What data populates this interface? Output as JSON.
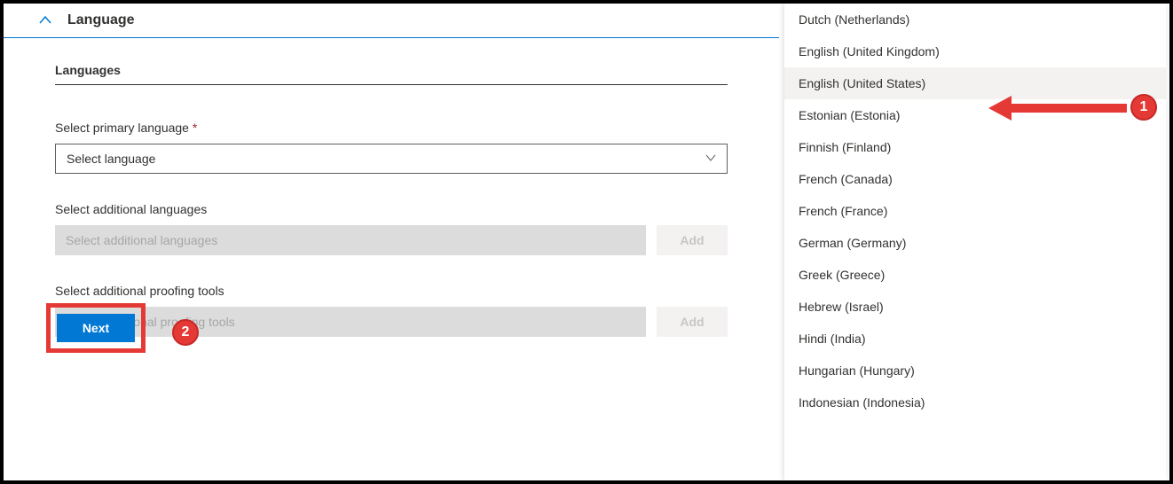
{
  "header": {
    "title": "Language"
  },
  "section": {
    "title": "Languages"
  },
  "primary": {
    "label": "Select primary language",
    "required": "*",
    "placeholder": "Select language"
  },
  "additionalLang": {
    "label": "Select additional languages",
    "placeholder": "Select additional languages",
    "add": "Add"
  },
  "proofing": {
    "label": "Select additional proofing tools",
    "placeholder": "Select additional proofing tools",
    "add": "Add"
  },
  "next": {
    "label": "Next"
  },
  "annot": {
    "b1": "1",
    "b2": "2"
  },
  "options": [
    "Dutch (Netherlands)",
    "English (United Kingdom)",
    "English (United States)",
    "Estonian (Estonia)",
    "Finnish (Finland)",
    "French (Canada)",
    "French (France)",
    "German (Germany)",
    "Greek (Greece)",
    "Hebrew (Israel)",
    "Hindi (India)",
    "Hungarian (Hungary)",
    "Indonesian (Indonesia)"
  ],
  "highlightIndex": 2
}
